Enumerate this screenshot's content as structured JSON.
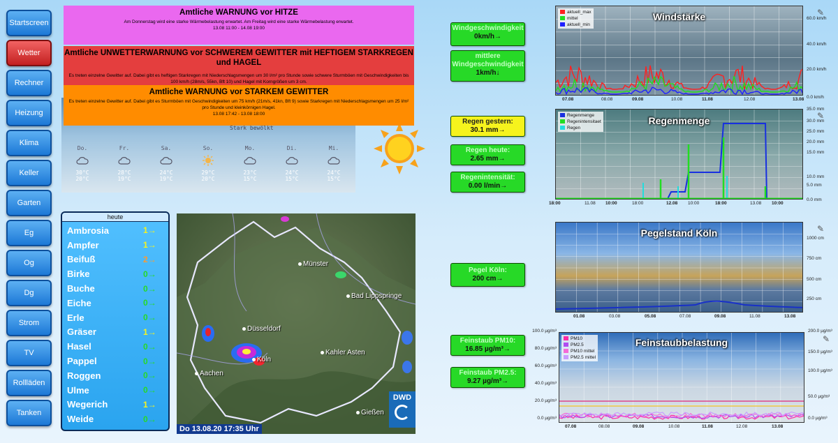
{
  "nav": [
    "Startscreen",
    "Wetter",
    "Rechner",
    "Heizung",
    "Klima",
    "Keller",
    "Garten",
    "Eg",
    "Og",
    "Dg",
    "Strom",
    "TV",
    "Rollläden",
    "Tanken"
  ],
  "nav_active": 1,
  "warnings": [
    {
      "title": "Amtliche WARNUNG vor HITZE",
      "text": "Am Donnerstag wird eine starke Wärmebelastung erwartet. Am Freitag wird eine starke Wärmebelastung erwartet.",
      "time": "13.08 11:00 - 14.08 19:00",
      "color": "#ea68ef"
    },
    {
      "title": "Amtliche UNWETTERWARNUNG vor SCHWEREM GEWITTER mit HEFTIGEM STARKREGEN und HAGEL",
      "text": "Es treten einzelne Gewitter auf. Dabei gibt es heftigen Starkregen mit Niederschlagsmengen um 30 l/m² pro Stunde sowie schwere Sturmböen mit Geschwindigkeiten bis 100 km/h (28m/s, 55kn, Bft 10) und Hagel mit Korngrößen um 3 cm.",
      "time": "",
      "color": "#e43e3e"
    },
    {
      "title": "Amtliche WARNUNG vor STARKEM GEWITTER",
      "text": "Es treten einzelne Gewitter auf. Dabei gibt es Sturmböen mit Geschwindigkeiten um 75 km/h (21m/s, 41kn, Bft 9) sowie Starkregen mit Niederschlagsmengen um 25 l/m² pro Stunde und kleinkörnigen Hagel.",
      "time": "13.08 17:42 - 13.08 18:00",
      "color": "#ff8c00"
    }
  ],
  "forecast": {
    "current": "Stark bewölkt",
    "days": [
      {
        "day": "Do.",
        "hi": "30°C",
        "lo": "20°C",
        "icon": "cloud-icon"
      },
      {
        "day": "Fr.",
        "hi": "28°C",
        "lo": "19°C",
        "icon": "cloud-icon"
      },
      {
        "day": "Sa.",
        "hi": "24°C",
        "lo": "19°C",
        "icon": "cloud-icon"
      },
      {
        "day": "So.",
        "hi": "29°C",
        "lo": "20°C",
        "icon": "sun-icon"
      },
      {
        "day": "Mo.",
        "hi": "23°C",
        "lo": "15°C",
        "icon": "cloud-icon"
      },
      {
        "day": "Di.",
        "hi": "24°C",
        "lo": "15°C",
        "icon": "cloud-icon"
      },
      {
        "day": "Mi.",
        "hi": "24°C",
        "lo": "15°C",
        "icon": "cloud-icon"
      }
    ]
  },
  "pollen": {
    "header": "heute",
    "items": [
      {
        "name": "Ambrosia",
        "level": "1",
        "arrow": "→",
        "color": "#f6f31d"
      },
      {
        "name": "Ampfer",
        "level": "1",
        "arrow": "→",
        "color": "#f6f31d"
      },
      {
        "name": "Beifuß",
        "level": "2",
        "arrow": "→",
        "color": "#ff9a2e"
      },
      {
        "name": "Birke",
        "level": "0",
        "arrow": "→",
        "color": "#27d927"
      },
      {
        "name": "Buche",
        "level": "0",
        "arrow": "→",
        "color": "#27d927"
      },
      {
        "name": "Eiche",
        "level": "0",
        "arrow": "→",
        "color": "#27d927"
      },
      {
        "name": "Erle",
        "level": "0",
        "arrow": "→",
        "color": "#27d927"
      },
      {
        "name": "Gräser",
        "level": "1",
        "arrow": "→",
        "color": "#f6f31d"
      },
      {
        "name": "Hasel",
        "level": "0",
        "arrow": "→",
        "color": "#27d927"
      },
      {
        "name": "Pappel",
        "level": "0",
        "arrow": "→",
        "color": "#27d927"
      },
      {
        "name": "Roggen",
        "level": "0",
        "arrow": "→",
        "color": "#27d927"
      },
      {
        "name": "Ulme",
        "level": "0",
        "arrow": "→",
        "color": "#27d927"
      },
      {
        "name": "Wegerich",
        "level": "1",
        "arrow": "→",
        "color": "#f6f31d"
      },
      {
        "name": "Weide",
        "level": "0",
        "arrow": "→",
        "color": "#27d927"
      }
    ]
  },
  "radar": {
    "timestamp": "Do 13.08.20  17:35 Uhr",
    "logo": "DWD",
    "cities": [
      "Münster",
      "Bad Lippspringe",
      "Düsseldorf",
      "Köln",
      "Kahler Asten",
      "Aachen",
      "Gießen"
    ]
  },
  "info": {
    "wind_label": "Windgeschwindigkeit",
    "wind_value": "0km/h→",
    "wind_avg_label": "mittlere Windgeschwindigkeit",
    "wind_avg_value": "1km/h↓",
    "rain_yesterday_label": "Regen gestern:",
    "rain_yesterday_value": "30.1 mm→",
    "rain_today_label": "Regen heute:",
    "rain_today_value": "2.65 mm→",
    "rain_rate_label": "Regenintensität:",
    "rain_rate_value": "0.00 l/min→",
    "pegel_label": "Pegel Köln:",
    "pegel_value": "200 cm→",
    "pm10_label": "Feinstaub PM10:",
    "pm10_value": "16.85 µg/m³→",
    "pm25_label": "Feinstaub PM2.5:",
    "pm25_value": "9.27 µg/m³→"
  },
  "charts": {
    "wind": {
      "title": "Windstärke",
      "legend": [
        "aktuell_max",
        "mittel",
        "aktuell_min"
      ],
      "colors": [
        "#ff2020",
        "#22dd22",
        "#2020ff"
      ],
      "yticks": [
        "60.0 km/h",
        "40.0 km/h",
        "20.0 km/h",
        "0.0 km/h"
      ],
      "xticks": [
        "07.08",
        "08.08",
        "09.08",
        "10.08",
        "11.08",
        "12.08",
        "13.08"
      ]
    },
    "rain": {
      "title": "Regenmenge",
      "legend": [
        "Regenmenge",
        "Regenintensitaet",
        "Regen"
      ],
      "colors": [
        "#1830e0",
        "#22dd22",
        "#22dddd"
      ],
      "yticks": [
        "35.0 mm",
        "30.0 mm",
        "25.0 mm",
        "20.0 mm",
        "15.0 mm",
        "10.0 mm",
        "5.0 mm",
        "0.0 mm"
      ],
      "xticks": [
        "18:00",
        "11.08",
        "10:00",
        "18:00",
        "12.08",
        "10:00",
        "18:00",
        "13.08",
        "10:00"
      ]
    },
    "pegel": {
      "title": "Pegelstand Köln",
      "yticks": [
        "1000 cm",
        "750 cm",
        "500 cm",
        "250 cm"
      ],
      "xticks": [
        "01.08",
        "03.08",
        "05.08",
        "07.08",
        "09.08",
        "11.08",
        "13.08"
      ]
    },
    "dust": {
      "title": "Feinstaubbelastung",
      "legend": [
        "PM10",
        "PM2.5",
        "PM10 mittel",
        "PM2.5 mittel"
      ],
      "colors": [
        "#ff2aa8",
        "#b04cf0",
        "#f56ad8",
        "#c89cff"
      ],
      "yticks_left": [
        "100.0 µg/m³",
        "80.0 µg/m³",
        "60.0 µg/m³",
        "40.0 µg/m³",
        "20.0 µg/m³",
        "0.0 µg/m³"
      ],
      "yticks_right": [
        "200.0 µg/m³",
        "150.0 µg/m³",
        "100.0 µg/m³",
        "50.0 µg/m³",
        "0.0 µg/m³"
      ],
      "xticks": [
        "07.08",
        "08.08",
        "09.08",
        "10.08",
        "11.08",
        "12.08",
        "13.08"
      ]
    }
  }
}
